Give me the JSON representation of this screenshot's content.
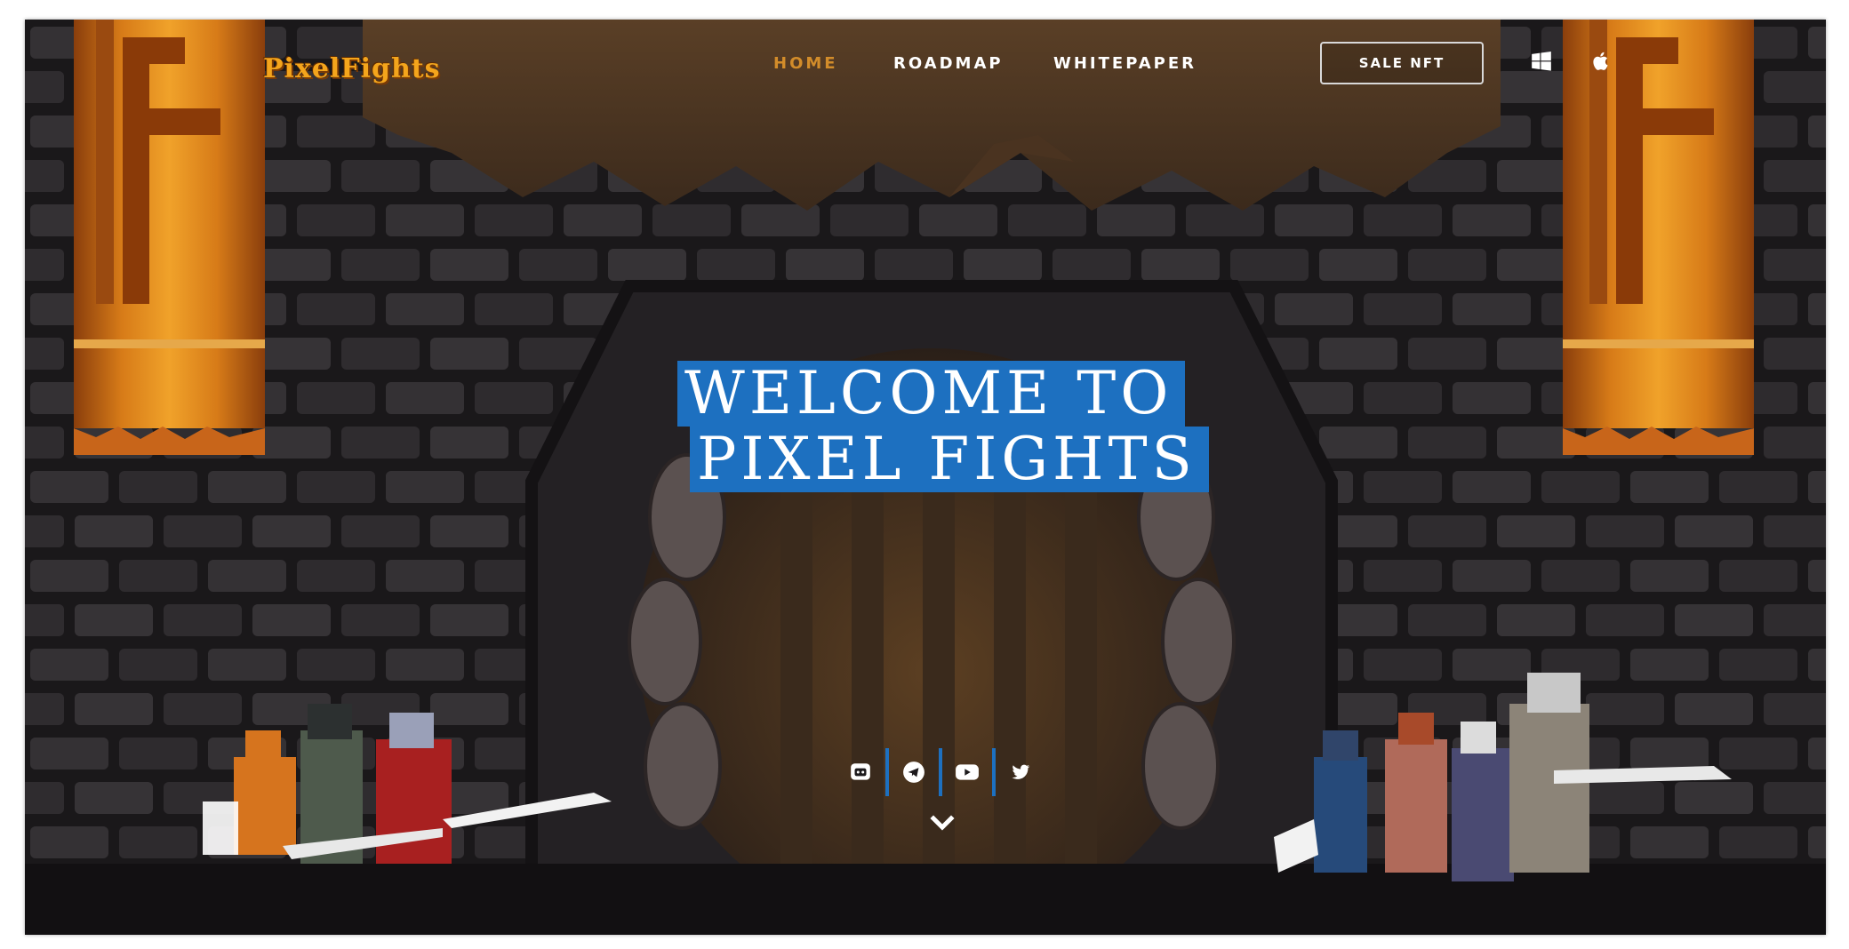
{
  "header": {
    "logo_text": "PixelFights",
    "nav": [
      {
        "label": "HOME",
        "active": true
      },
      {
        "label": "ROADMAP",
        "active": false
      },
      {
        "label": "WHITEPAPER",
        "active": false
      }
    ],
    "cta_label": "SALE NFT",
    "os_icons": [
      "windows-icon",
      "apple-icon"
    ]
  },
  "hero": {
    "title_line1": "WELCOME TO",
    "title_line2": "PIXEL FIGHTS",
    "highlight_color": "#1d70c0"
  },
  "social": [
    "discord-icon",
    "telegram-icon",
    "youtube-icon",
    "twitter-icon"
  ],
  "scroll_icon": "chevron-down-icon",
  "colors": {
    "accent": "#d28c2a",
    "logo": "#f4a51c",
    "background": "#1c1a1c"
  }
}
